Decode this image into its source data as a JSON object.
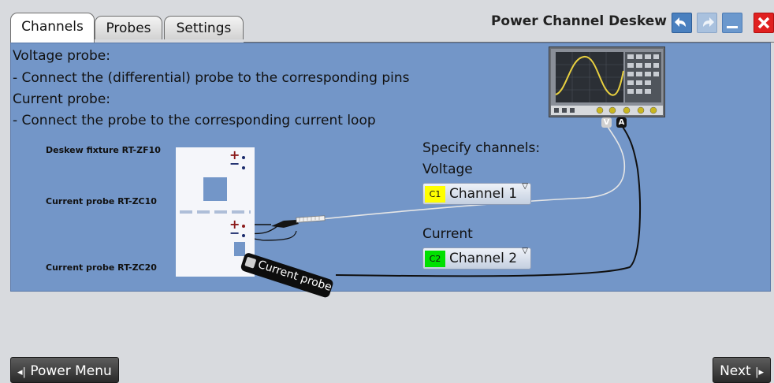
{
  "tabs": [
    {
      "label": "Channels",
      "active": true
    },
    {
      "label": "Probes",
      "active": false
    },
    {
      "label": "Settings",
      "active": false
    }
  ],
  "title": "Power Channel Deskew",
  "window_buttons": {
    "undo": "undo-arrow-icon",
    "redo": "redo-arrow-icon",
    "minimize": "minimize-icon",
    "close": "close-icon"
  },
  "instructions": {
    "voltage_heading": "Voltage probe:",
    "voltage_step": "- Connect the (differential) probe to the corresponding pins",
    "current_heading": "Current probe:",
    "current_step": "- Connect the probe to the corresponding current loop"
  },
  "diagram": {
    "fixture_label": "Deskew fixture RT-ZF10",
    "probe_zc10_label": "Current probe RT-ZC10",
    "probe_zc20_label": "Current probe RT-ZC20",
    "current_probe_text": "Current probe",
    "connector_v": "V",
    "connector_a": "A",
    "pin_plus": "+",
    "pin_minus": "−"
  },
  "channels": {
    "heading": "Specify channels:",
    "voltage_label": "Voltage",
    "voltage_channel": {
      "badge": "C1",
      "value": "Channel 1",
      "color": "#ffff00"
    },
    "current_label": "Current",
    "current_channel": {
      "badge": "C2",
      "value": "Channel 2",
      "color": "#00e000"
    }
  },
  "nav": {
    "back_icon": "◂|",
    "back_label": "Power Menu",
    "next_label": "Next",
    "next_icon": "|▸"
  },
  "colors": {
    "panel": "#7396c8",
    "close_button": "#e02020",
    "nav_button": "#3a3a3a"
  }
}
